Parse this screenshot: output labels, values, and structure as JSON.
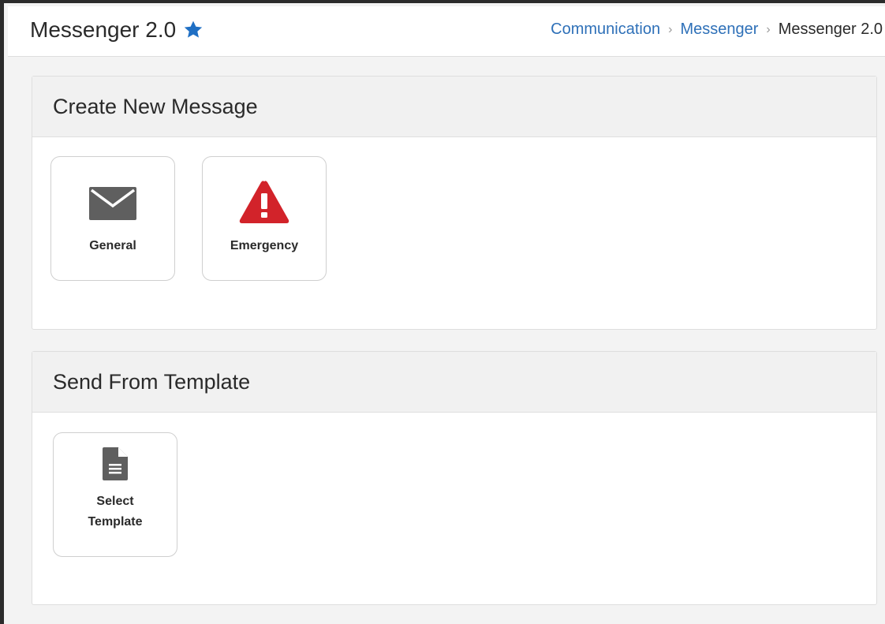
{
  "header": {
    "title": "Messenger 2.0",
    "favorite_icon": "star-icon",
    "breadcrumb": {
      "items": [
        "Communication",
        "Messenger",
        "Messenger 2.0"
      ],
      "separator": ">"
    }
  },
  "create_panel": {
    "title": "Create New Message",
    "tiles": [
      {
        "label": "General",
        "icon": "envelope-icon"
      },
      {
        "label": "Emergency",
        "icon": "warning-icon"
      }
    ]
  },
  "template_panel": {
    "title": "Send From Template",
    "tiles": [
      {
        "label": "Select Template",
        "icon": "document-icon"
      }
    ]
  },
  "colors": {
    "accent": "#2e70b8",
    "emergency": "#d2232a",
    "icon_gray": "#5f5f5f"
  }
}
